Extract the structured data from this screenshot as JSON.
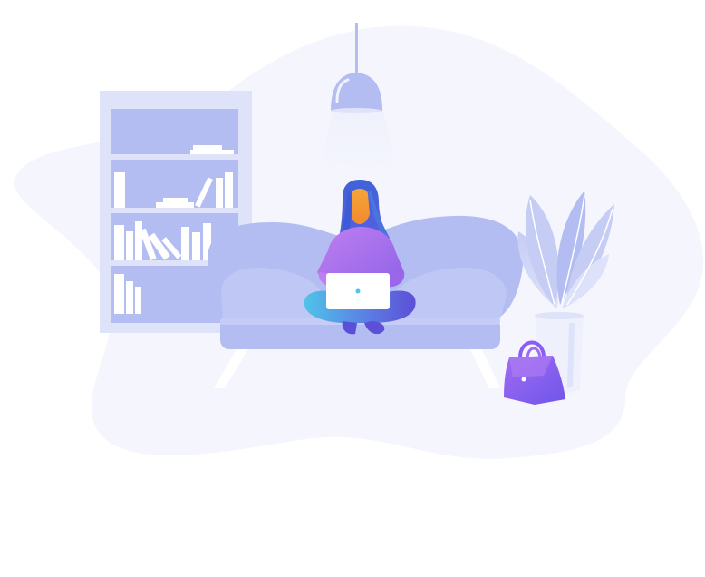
{
  "illustration": {
    "subject": "woman-working-on-laptop-on-sofa",
    "icons": [
      "bookshelf-icon",
      "pendant-lamp-icon",
      "sofa-icon",
      "woman-figure-icon",
      "laptop-icon",
      "potted-plant-icon",
      "handbag-icon"
    ],
    "colors": {
      "background": "#ffffff",
      "blob": "#f5f6fd",
      "furniture": "#b3bdf2",
      "furniture_light": "#c5cdf7",
      "accent_purple": "#8b5cf6",
      "accent_blue": "#4fc3e8",
      "hair": "#4a5bd6",
      "skin": "#f7a23a",
      "white": "#ffffff"
    }
  }
}
